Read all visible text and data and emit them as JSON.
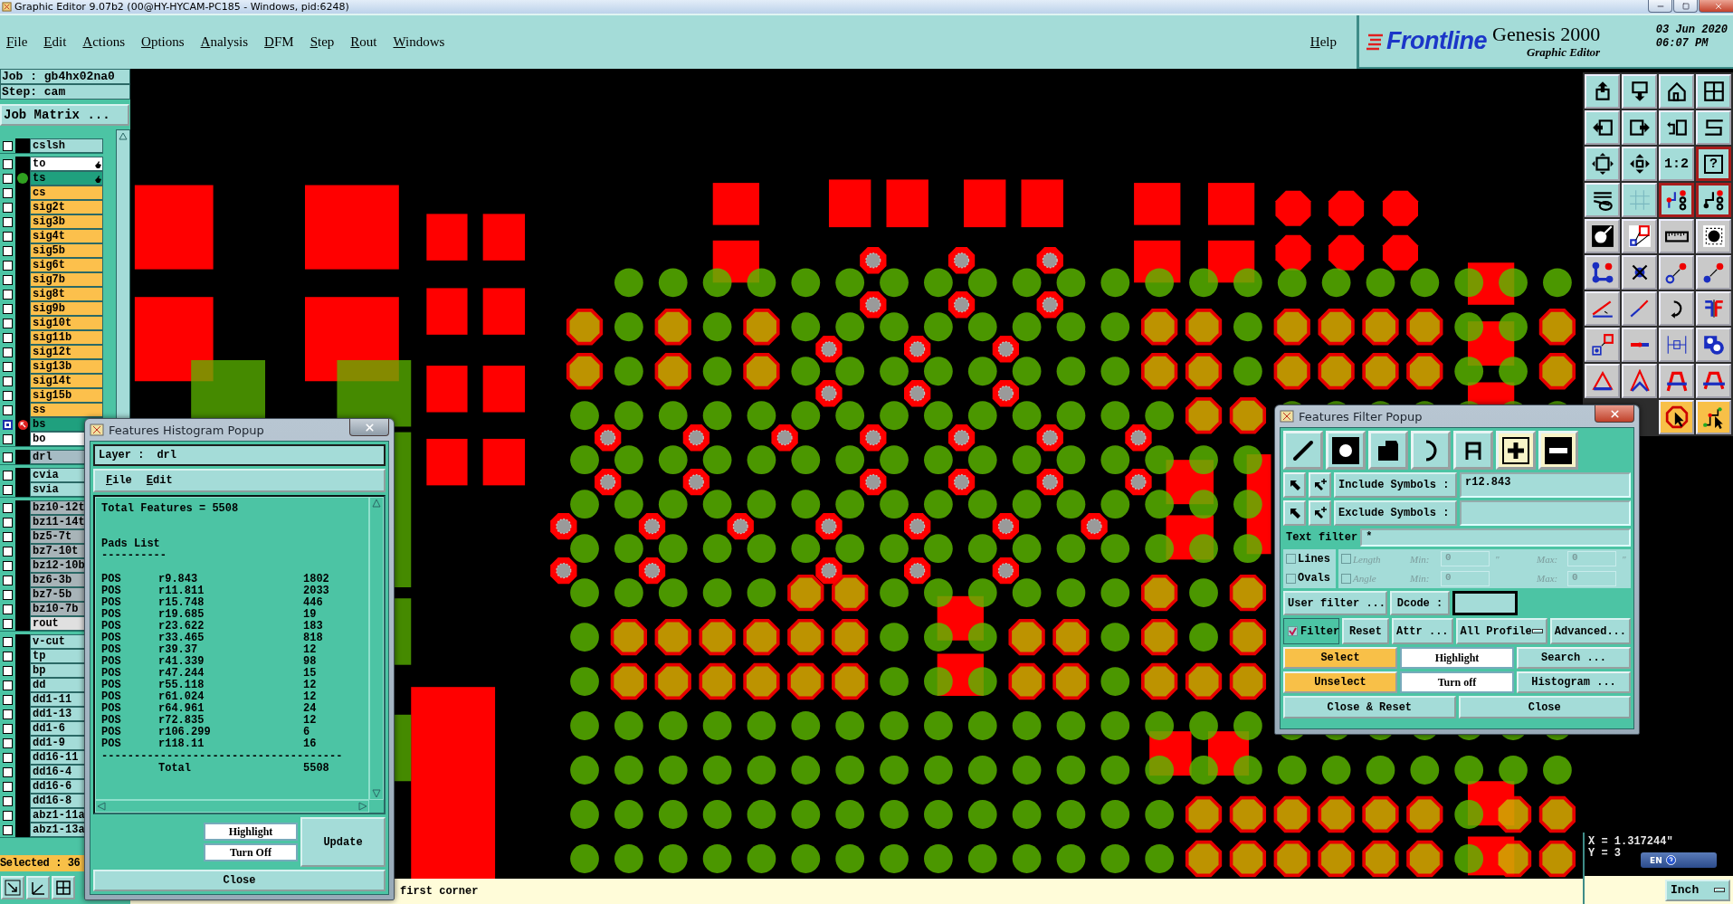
{
  "window": {
    "title": "Graphic Editor 9.07b2 (00@HY-HYCAM-PC185 - Windows, pid:6248)"
  },
  "menu": [
    "File",
    "Edit",
    "Actions",
    "Options",
    "Analysis",
    "DFM",
    "Step",
    "Rout",
    "Windows"
  ],
  "help": "Help",
  "brand": {
    "logo": "Frontline",
    "product": "Genesis 2000",
    "subtitle": "Graphic Editor",
    "date": "03 Jun 2020",
    "time": "06:07 PM"
  },
  "job": {
    "job_label": "Job : gb4hx02na0",
    "step_label": "Step: cam",
    "matrix_button": "Job Matrix ..."
  },
  "layer_groups": [
    [
      {
        "name": "cslsh",
        "color": "#a4dcd8",
        "selected": false
      }
    ],
    [
      {
        "name": "to",
        "color": "#ffffff",
        "selected": false,
        "hand": true
      },
      {
        "name": "ts",
        "color": "#1fa07e",
        "selected": false,
        "hand": true,
        "work": true
      },
      {
        "name": "cs",
        "color": "#fcc04c",
        "selected": false
      },
      {
        "name": "sig2t",
        "color": "#fcc04c",
        "selected": false
      },
      {
        "name": "sig3b",
        "color": "#fcc04c",
        "selected": false
      },
      {
        "name": "sig4t",
        "color": "#fcc04c",
        "selected": false
      },
      {
        "name": "sig5b",
        "color": "#fcc04c",
        "selected": false
      },
      {
        "name": "sig6t",
        "color": "#fcc04c",
        "selected": false
      },
      {
        "name": "sig7b",
        "color": "#fcc04c",
        "selected": false
      },
      {
        "name": "sig8t",
        "color": "#fcc04c",
        "selected": false
      },
      {
        "name": "sig9b",
        "color": "#fcc04c",
        "selected": false
      },
      {
        "name": "sig10t",
        "color": "#fcc04c",
        "selected": false
      },
      {
        "name": "sig11b",
        "color": "#fcc04c",
        "selected": false
      },
      {
        "name": "sig12t",
        "color": "#fcc04c",
        "selected": false
      },
      {
        "name": "sig13b",
        "color": "#fcc04c",
        "selected": false
      },
      {
        "name": "sig14t",
        "color": "#fcc04c",
        "selected": false
      },
      {
        "name": "sig15b",
        "color": "#fcc04c",
        "selected": false
      },
      {
        "name": "ss",
        "color": "#fcc04c",
        "selected": false
      },
      {
        "name": "bs",
        "color": "#1fa07e",
        "selected": true,
        "affected": true
      },
      {
        "name": "bo",
        "color": "#ffffff",
        "selected": false
      }
    ],
    [
      {
        "name": "drl",
        "color": "#a6bcc4",
        "selected": false
      }
    ],
    [
      {
        "name": "cvia",
        "color": "#a4dcd8",
        "selected": false
      },
      {
        "name": "svia",
        "color": "#a4dcd8",
        "selected": false
      }
    ],
    [
      {
        "name": "bz10-12t",
        "color": "#a8b4b8",
        "selected": false
      },
      {
        "name": "bz11-14t",
        "color": "#a8b4b8",
        "selected": false
      },
      {
        "name": "bz5-7t",
        "color": "#a8b4b8",
        "selected": false
      },
      {
        "name": "bz7-10t",
        "color": "#a8b4b8",
        "selected": false
      },
      {
        "name": "bz12-10b",
        "color": "#a8b4b8",
        "selected": false
      },
      {
        "name": "bz6-3b",
        "color": "#a8b4b8",
        "selected": false
      },
      {
        "name": "bz7-5b",
        "color": "#a8b4b8",
        "selected": false
      },
      {
        "name": "bz10-7b",
        "color": "#a8b4b8",
        "selected": false
      },
      {
        "name": "rout",
        "color": "#e0e0e0",
        "selected": false
      }
    ],
    [
      {
        "name": "v-cut",
        "color": "#a4dcd8",
        "selected": false
      },
      {
        "name": "tp",
        "color": "#a4dcd8",
        "selected": false
      },
      {
        "name": "bp",
        "color": "#a4dcd8",
        "selected": false
      },
      {
        "name": "dd",
        "color": "#a4dcd8",
        "selected": false
      },
      {
        "name": "dd1-11",
        "color": "#a4dcd8",
        "selected": false
      },
      {
        "name": "dd1-13",
        "color": "#a4dcd8",
        "selected": false
      },
      {
        "name": "dd1-6",
        "color": "#a4dcd8",
        "selected": false
      },
      {
        "name": "dd1-9",
        "color": "#a4dcd8",
        "selected": false
      },
      {
        "name": "dd16-11",
        "color": "#a4dcd8",
        "selected": false
      },
      {
        "name": "dd16-4",
        "color": "#a4dcd8",
        "selected": false
      },
      {
        "name": "dd16-6",
        "color": "#a4dcd8",
        "selected": false
      },
      {
        "name": "dd16-8",
        "color": "#a4dcd8",
        "selected": false
      },
      {
        "name": "abz1-11a",
        "color": "#a4dcd8",
        "selected": false
      },
      {
        "name": "abz1-13a",
        "color": "#a4dcd8",
        "selected": false
      }
    ]
  ],
  "selected_count": "Selected : 36",
  "tools": [
    {
      "kind": "view",
      "highlighted": false
    },
    {
      "kind": "view",
      "highlighted": false
    },
    {
      "kind": "view",
      "highlighted": false
    },
    {
      "kind": "view",
      "highlighted": false
    },
    {
      "kind": "view",
      "highlighted": false
    },
    {
      "kind": "view",
      "highlighted": false
    },
    {
      "kind": "view",
      "highlighted": false
    },
    {
      "kind": "view",
      "highlighted": false
    },
    {
      "kind": "view",
      "highlighted": false
    },
    {
      "kind": "view",
      "highlighted": false
    },
    {
      "kind": "view",
      "highlighted": false,
      "label": "1:2"
    },
    {
      "kind": "view",
      "highlighted": true,
      "label": "?"
    },
    {
      "kind": "view",
      "highlighted": false
    },
    {
      "kind": "view",
      "highlighted": false
    },
    {
      "kind": "view",
      "highlighted": true
    },
    {
      "kind": "view",
      "highlighted": true
    },
    {
      "kind": "edit",
      "highlighted": false
    },
    {
      "kind": "edit",
      "highlighted": false
    },
    {
      "kind": "edit",
      "highlighted": false
    },
    {
      "kind": "edit",
      "highlighted": false
    },
    {
      "kind": "edit",
      "highlighted": false
    },
    {
      "kind": "edit",
      "highlighted": false
    },
    {
      "kind": "edit",
      "highlighted": false
    },
    {
      "kind": "edit",
      "highlighted": false
    },
    {
      "kind": "edit",
      "highlighted": false
    },
    {
      "kind": "edit",
      "highlighted": false
    },
    {
      "kind": "edit",
      "highlighted": false
    },
    {
      "kind": "edit",
      "highlighted": false
    },
    {
      "kind": "edit",
      "highlighted": false
    },
    {
      "kind": "edit",
      "highlighted": false
    },
    {
      "kind": "edit",
      "highlighted": false
    },
    {
      "kind": "edit",
      "highlighted": false
    },
    {
      "kind": "edit",
      "highlighted": false
    },
    {
      "kind": "edit",
      "highlighted": false
    },
    {
      "kind": "edit",
      "highlighted": false
    },
    {
      "kind": "edit",
      "highlighted": false
    },
    {
      "kind": "mode",
      "highlighted": false
    },
    {
      "kind": "mode",
      "highlighted": false
    }
  ],
  "coordinates": {
    "x": "X = 1.317244\"",
    "y": "Y = 3"
  },
  "ime": {
    "language": "EN"
  },
  "status": {
    "prompt": "first corner",
    "units": "Inch"
  },
  "histogram": {
    "title": "Features Histogram Popup",
    "layer_label": "Layer :",
    "layer": "drl",
    "menu": [
      "File",
      "Edit"
    ],
    "summary": "Total Features = 5508",
    "section": "Pads List",
    "section_rule": "----------",
    "rows": [
      {
        "type": "POS",
        "symbol": "r9.843",
        "count": "1802"
      },
      {
        "type": "POS",
        "symbol": "r11.811",
        "count": "2033"
      },
      {
        "type": "POS",
        "symbol": "r15.748",
        "count": "446"
      },
      {
        "type": "POS",
        "symbol": "r19.685",
        "count": "19"
      },
      {
        "type": "POS",
        "symbol": "r23.622",
        "count": "183"
      },
      {
        "type": "POS",
        "symbol": "r33.465",
        "count": "818"
      },
      {
        "type": "POS",
        "symbol": "r39.37",
        "count": "12"
      },
      {
        "type": "POS",
        "symbol": "r41.339",
        "count": "98"
      },
      {
        "type": "POS",
        "symbol": "r47.244",
        "count": "15"
      },
      {
        "type": "POS",
        "symbol": "r55.118",
        "count": "12"
      },
      {
        "type": "POS",
        "symbol": "r61.024",
        "count": "12"
      },
      {
        "type": "POS",
        "symbol": "r64.961",
        "count": "24"
      },
      {
        "type": "POS",
        "symbol": "r72.835",
        "count": "12"
      },
      {
        "type": "POS",
        "symbol": "r106.299",
        "count": "6"
      },
      {
        "type": "POS",
        "symbol": "r118.11",
        "count": "16"
      }
    ],
    "total_rule": "-------------------------------------",
    "total_label": "Total",
    "total": "5508",
    "buttons": {
      "highlight": "Highlight",
      "turn_off": "Turn Off",
      "update": "Update",
      "close": "Close"
    }
  },
  "filter": {
    "title": "Features Filter Popup",
    "include": {
      "label": "Include Symbols :",
      "value": "r12.843"
    },
    "exclude": {
      "label": "Exclude Symbols :"
    },
    "text_filter": {
      "label": "Text filter",
      "value": "*"
    },
    "types": [
      {
        "label": "Lines",
        "checked": false
      },
      {
        "label": "Ovals",
        "checked": false
      }
    ],
    "ranges": [
      {
        "label": "Length",
        "checked": false,
        "disabled": true,
        "min_label": "Min:",
        "min": "0",
        "max_label": "Max:",
        "max": "0",
        "unit": "\""
      },
      {
        "label": "Angle",
        "checked": false,
        "disabled": true,
        "min_label": "Min:",
        "min": "0",
        "max_label": "Max:",
        "max": "0"
      }
    ],
    "user_filter": "User filter ...",
    "dcode_label": "Dcode :",
    "filter_toggle": {
      "label": "Filter",
      "checked": true
    },
    "options": [
      {
        "label": "Reset",
        "kind": "button"
      },
      {
        "label": "Attr ...",
        "kind": "button"
      },
      {
        "label": "All Profile",
        "kind": "option"
      },
      {
        "label": "Advanced...",
        "kind": "button"
      }
    ],
    "actions": [
      {
        "label": "Select",
        "kind": "select"
      },
      {
        "label": "Highlight",
        "kind": "highlight"
      },
      {
        "label": "Search ...",
        "kind": "dialog"
      },
      {
        "label": "Unselect",
        "kind": "select"
      },
      {
        "label": "Turn off",
        "kind": "highlight"
      },
      {
        "label": "Histogram ...",
        "kind": "dialog"
      }
    ],
    "footer": [
      "Close & Reset",
      "Close"
    ]
  }
}
